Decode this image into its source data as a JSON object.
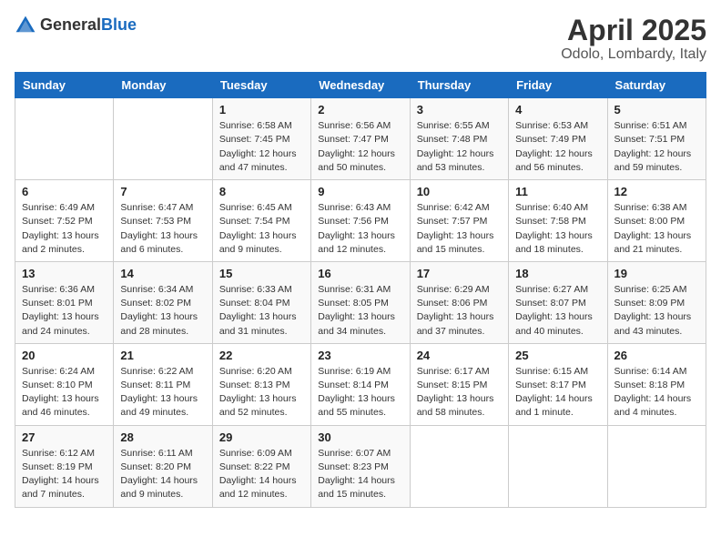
{
  "logo": {
    "general": "General",
    "blue": "Blue"
  },
  "header": {
    "month": "April 2025",
    "location": "Odolo, Lombardy, Italy"
  },
  "weekdays": [
    "Sunday",
    "Monday",
    "Tuesday",
    "Wednesday",
    "Thursday",
    "Friday",
    "Saturday"
  ],
  "weeks": [
    [
      {
        "day": "",
        "info": ""
      },
      {
        "day": "",
        "info": ""
      },
      {
        "day": "1",
        "info": "Sunrise: 6:58 AM\nSunset: 7:45 PM\nDaylight: 12 hours and 47 minutes."
      },
      {
        "day": "2",
        "info": "Sunrise: 6:56 AM\nSunset: 7:47 PM\nDaylight: 12 hours and 50 minutes."
      },
      {
        "day": "3",
        "info": "Sunrise: 6:55 AM\nSunset: 7:48 PM\nDaylight: 12 hours and 53 minutes."
      },
      {
        "day": "4",
        "info": "Sunrise: 6:53 AM\nSunset: 7:49 PM\nDaylight: 12 hours and 56 minutes."
      },
      {
        "day": "5",
        "info": "Sunrise: 6:51 AM\nSunset: 7:51 PM\nDaylight: 12 hours and 59 minutes."
      }
    ],
    [
      {
        "day": "6",
        "info": "Sunrise: 6:49 AM\nSunset: 7:52 PM\nDaylight: 13 hours and 2 minutes."
      },
      {
        "day": "7",
        "info": "Sunrise: 6:47 AM\nSunset: 7:53 PM\nDaylight: 13 hours and 6 minutes."
      },
      {
        "day": "8",
        "info": "Sunrise: 6:45 AM\nSunset: 7:54 PM\nDaylight: 13 hours and 9 minutes."
      },
      {
        "day": "9",
        "info": "Sunrise: 6:43 AM\nSunset: 7:56 PM\nDaylight: 13 hours and 12 minutes."
      },
      {
        "day": "10",
        "info": "Sunrise: 6:42 AM\nSunset: 7:57 PM\nDaylight: 13 hours and 15 minutes."
      },
      {
        "day": "11",
        "info": "Sunrise: 6:40 AM\nSunset: 7:58 PM\nDaylight: 13 hours and 18 minutes."
      },
      {
        "day": "12",
        "info": "Sunrise: 6:38 AM\nSunset: 8:00 PM\nDaylight: 13 hours and 21 minutes."
      }
    ],
    [
      {
        "day": "13",
        "info": "Sunrise: 6:36 AM\nSunset: 8:01 PM\nDaylight: 13 hours and 24 minutes."
      },
      {
        "day": "14",
        "info": "Sunrise: 6:34 AM\nSunset: 8:02 PM\nDaylight: 13 hours and 28 minutes."
      },
      {
        "day": "15",
        "info": "Sunrise: 6:33 AM\nSunset: 8:04 PM\nDaylight: 13 hours and 31 minutes."
      },
      {
        "day": "16",
        "info": "Sunrise: 6:31 AM\nSunset: 8:05 PM\nDaylight: 13 hours and 34 minutes."
      },
      {
        "day": "17",
        "info": "Sunrise: 6:29 AM\nSunset: 8:06 PM\nDaylight: 13 hours and 37 minutes."
      },
      {
        "day": "18",
        "info": "Sunrise: 6:27 AM\nSunset: 8:07 PM\nDaylight: 13 hours and 40 minutes."
      },
      {
        "day": "19",
        "info": "Sunrise: 6:25 AM\nSunset: 8:09 PM\nDaylight: 13 hours and 43 minutes."
      }
    ],
    [
      {
        "day": "20",
        "info": "Sunrise: 6:24 AM\nSunset: 8:10 PM\nDaylight: 13 hours and 46 minutes."
      },
      {
        "day": "21",
        "info": "Sunrise: 6:22 AM\nSunset: 8:11 PM\nDaylight: 13 hours and 49 minutes."
      },
      {
        "day": "22",
        "info": "Sunrise: 6:20 AM\nSunset: 8:13 PM\nDaylight: 13 hours and 52 minutes."
      },
      {
        "day": "23",
        "info": "Sunrise: 6:19 AM\nSunset: 8:14 PM\nDaylight: 13 hours and 55 minutes."
      },
      {
        "day": "24",
        "info": "Sunrise: 6:17 AM\nSunset: 8:15 PM\nDaylight: 13 hours and 58 minutes."
      },
      {
        "day": "25",
        "info": "Sunrise: 6:15 AM\nSunset: 8:17 PM\nDaylight: 14 hours and 1 minute."
      },
      {
        "day": "26",
        "info": "Sunrise: 6:14 AM\nSunset: 8:18 PM\nDaylight: 14 hours and 4 minutes."
      }
    ],
    [
      {
        "day": "27",
        "info": "Sunrise: 6:12 AM\nSunset: 8:19 PM\nDaylight: 14 hours and 7 minutes."
      },
      {
        "day": "28",
        "info": "Sunrise: 6:11 AM\nSunset: 8:20 PM\nDaylight: 14 hours and 9 minutes."
      },
      {
        "day": "29",
        "info": "Sunrise: 6:09 AM\nSunset: 8:22 PM\nDaylight: 14 hours and 12 minutes."
      },
      {
        "day": "30",
        "info": "Sunrise: 6:07 AM\nSunset: 8:23 PM\nDaylight: 14 hours and 15 minutes."
      },
      {
        "day": "",
        "info": ""
      },
      {
        "day": "",
        "info": ""
      },
      {
        "day": "",
        "info": ""
      }
    ]
  ]
}
